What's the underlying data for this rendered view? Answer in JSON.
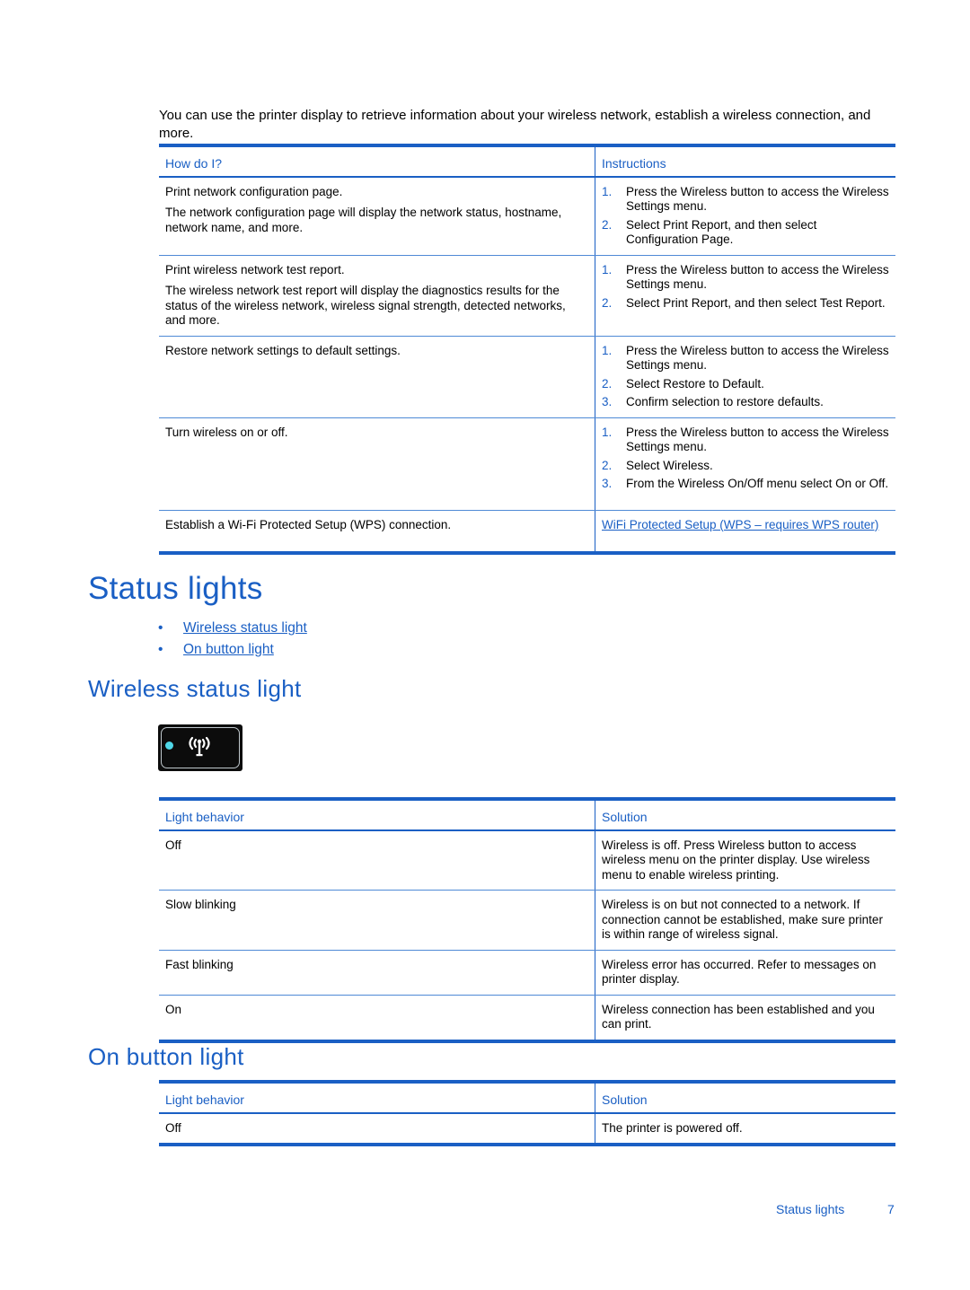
{
  "intro": "You can use the printer display to retrieve information about your wireless network, establish a wireless connection, and more.",
  "network_table": {
    "headers": [
      "How do I?",
      "Instructions"
    ],
    "rows": [
      {
        "task": "Print network configuration page.",
        "detail": "The network configuration page will display the network status, hostname, network name, and more.",
        "steps": [
          "Press the Wireless button to access the Wireless Settings menu.",
          "Select Print Report, and then select Configuration Page."
        ]
      },
      {
        "task": "Print wireless network test report.",
        "detail": "The wireless network test report will display the diagnostics results for the status of the wireless network, wireless signal strength, detected networks, and more.",
        "steps": [
          "Press the Wireless button to access the Wireless Settings menu.",
          "Select Print Report, and then select Test Report."
        ]
      },
      {
        "task": "Restore network settings to default settings.",
        "steps": [
          "Press the Wireless button to access the Wireless Settings menu.",
          "Select Restore to Default.",
          "Confirm selection to restore defaults."
        ]
      },
      {
        "task": "Turn wireless on or off.",
        "steps": [
          "Press the Wireless button to access the Wireless Settings menu.",
          "Select Wireless.",
          "From the Wireless On/Off menu select On or Off."
        ]
      },
      {
        "task": "Establish a Wi-Fi Protected Setup (WPS) connection.",
        "link": "WiFi Protected Setup (WPS – requires WPS router)"
      }
    ]
  },
  "status_lights": {
    "title": "Status lights",
    "toc": [
      "Wireless status light",
      "On button light"
    ]
  },
  "wireless_section": {
    "title": "Wireless status light",
    "panel_icon": "wireless-antenna-icon",
    "led_color": "#4fd7e8",
    "table": {
      "headers": [
        "Light behavior",
        "Solution"
      ],
      "rows": [
        {
          "behavior": "Off",
          "solution": "Wireless is off. Press Wireless button to access wireless menu on the printer display. Use wireless menu to enable wireless printing."
        },
        {
          "behavior": "Slow blinking",
          "solution": "Wireless is on but not connected to a network. If connection cannot be established, make sure printer is within range of wireless signal."
        },
        {
          "behavior": "Fast blinking",
          "solution": "Wireless error has occurred. Refer to messages on printer display."
        },
        {
          "behavior": "On",
          "solution": "Wireless connection has been established and you can print."
        }
      ]
    }
  },
  "on_button_section": {
    "title": "On button light",
    "table": {
      "headers": [
        "Light behavior",
        "Solution"
      ],
      "rows": [
        {
          "behavior": "Off",
          "solution": "The printer is powered off."
        }
      ]
    }
  },
  "footer": {
    "section": "Status lights",
    "page": "7"
  },
  "colors": {
    "accent": "#1a5fc4"
  }
}
